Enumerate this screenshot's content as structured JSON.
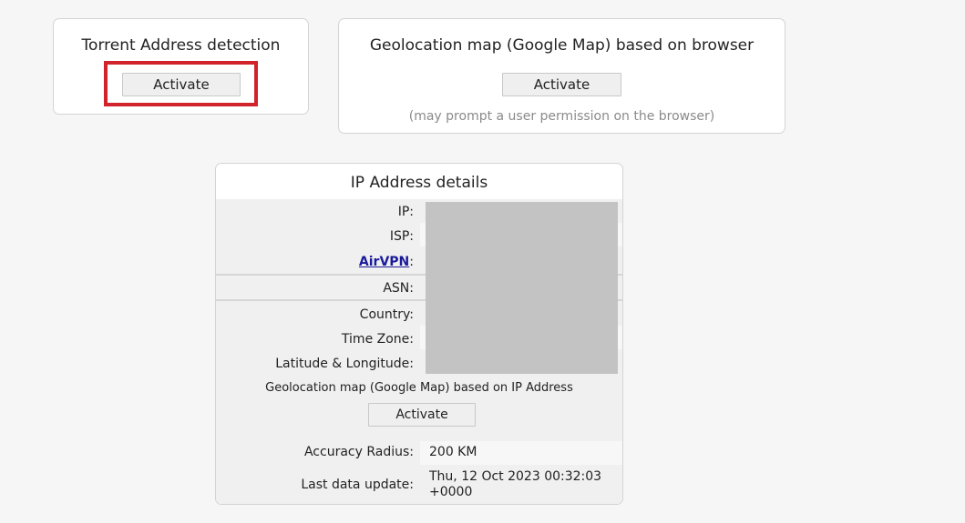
{
  "torrent": {
    "title": "Torrent Address detection",
    "button_label": "Activate"
  },
  "geo_browser": {
    "title": "Geolocation map (Google Map) based on browser",
    "button_label": "Activate",
    "note": "(may prompt a user permission on the browser)"
  },
  "ip_details": {
    "title": "IP Address details",
    "ip_label": "IP:",
    "isp_label": "ISP:",
    "airvpn_link": "AirVPN",
    "airvpn_suffix": ":",
    "asn_label": "ASN:",
    "country_label": "Country:",
    "timezone_label": "Time Zone:",
    "latlong_label": "Latitude & Longitude:",
    "map_caption": "Geolocation map (Google Map) based on IP Address",
    "map_button_label": "Activate",
    "accuracy_label": "Accuracy Radius:",
    "accuracy_value": "200 KM",
    "last_update_label": "Last data update:",
    "last_update_value_line1": "Thu, 12 Oct 2023 00:32:03",
    "last_update_value_line2": "+0000"
  },
  "colors": {
    "highlight": "#d0232c",
    "link": "#1a1a99",
    "redaction": "#c3c3c3"
  }
}
